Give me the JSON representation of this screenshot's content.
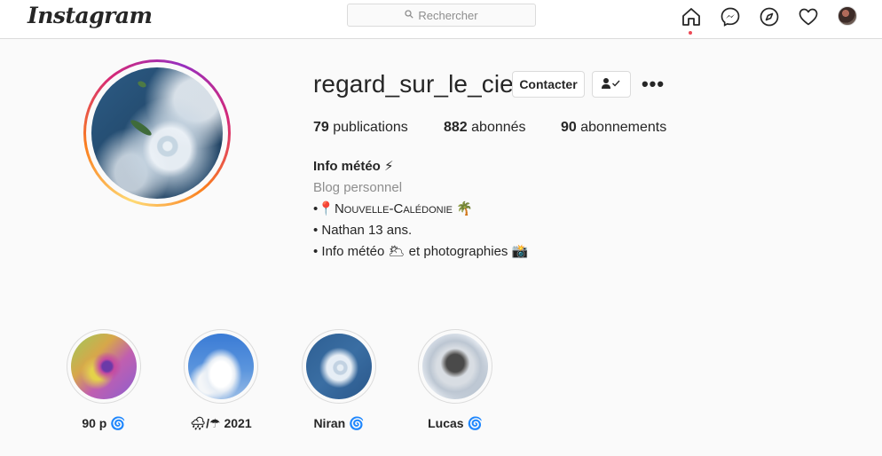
{
  "topbar": {
    "logo": "Instagram",
    "search_placeholder": "Rechercher",
    "search_icon": "search-icon",
    "nav_icons": [
      "home-icon",
      "messenger-icon",
      "explore-compass-icon",
      "heart-icon",
      "avatar"
    ]
  },
  "profile": {
    "username": "regard_sur_le_ciel",
    "contact_label": "Contacter",
    "follow_icon": "user-check-icon",
    "more_label": "•••",
    "stats": {
      "posts_count": "79",
      "posts_label": "publications",
      "followers_count": "882",
      "followers_label": "abonnés",
      "following_count": "90",
      "following_label": "abonnements"
    },
    "bio": {
      "name": "Info météo ⚡",
      "category": "Blog personnel",
      "line1_prefix": "•📍",
      "line1_text": "Nouvelle-Calédonie",
      "line1_suffix": " 🌴",
      "line2": "• Nathan 13 ans.",
      "line3": "• Info météo 🌥 et photographies 📸"
    }
  },
  "highlights": [
    {
      "label": "90 p 🌀"
    },
    {
      "label": "🌧/☂ 2021"
    },
    {
      "label": "Niran 🌀"
    },
    {
      "label": "Lucas 🌀"
    }
  ],
  "colors": {
    "background": "#fafafa",
    "border": "#dbdbdb",
    "text": "#262626",
    "secondary_text": "#8e8e8e",
    "notification_dot": "#ed4956"
  }
}
